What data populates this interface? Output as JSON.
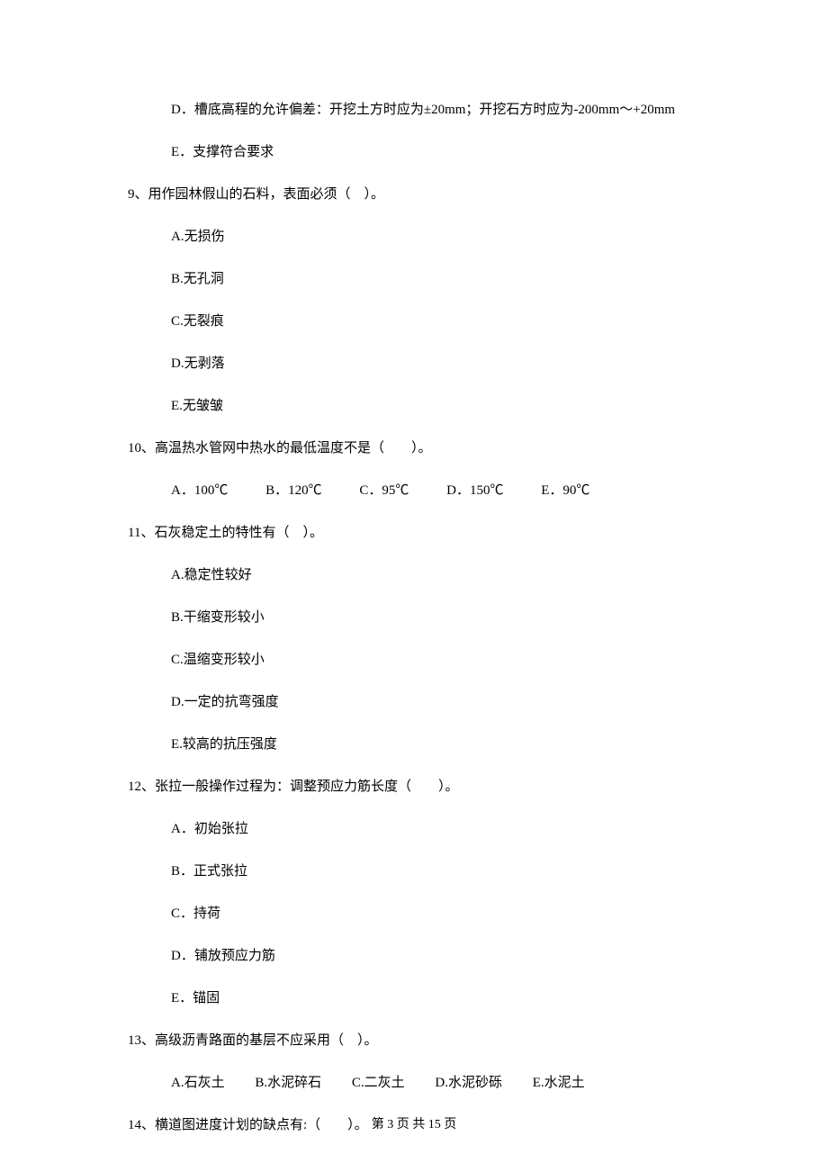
{
  "pre_options": {
    "D": "D．槽底高程的允许偏差：开挖土方时应为±20mm；开挖石方时应为-200mm～+20mm",
    "E": "E．支撑符合要求"
  },
  "q9": {
    "stem": "9、用作园林假山的石料，表面必须（　）。",
    "A": "A.无损伤",
    "B": "B.无孔洞",
    "C": "C.无裂痕",
    "D": "D.无剥落",
    "E": "E.无皱皱"
  },
  "q10": {
    "stem": "10、高温热水管网中热水的最低温度不是（　　）。",
    "A": "A．100℃",
    "B": "B．120℃",
    "C": "C．95℃",
    "D": "D．150℃",
    "E": "E．90℃"
  },
  "q11": {
    "stem": "11、石灰稳定土的特性有（　）。",
    "A": "A.稳定性较好",
    "B": "B.干缩变形较小",
    "C": "C.温缩变形较小",
    "D": "D.一定的抗弯强度",
    "E": "E.较高的抗压强度"
  },
  "q12": {
    "stem": "12、张拉一般操作过程为：调整预应力筋长度（　　）。",
    "A": "A．初始张拉",
    "B": "B．正式张拉",
    "C": "C．持荷",
    "D": "D．铺放预应力筋",
    "E": "E．锚固"
  },
  "q13": {
    "stem": "13、高级沥青路面的基层不应采用（　）。",
    "A": "A.石灰土",
    "B": "B.水泥碎石",
    "C": "C.二灰土",
    "D": "D.水泥砂砾",
    "E": "E.水泥土"
  },
  "q14": {
    "stem": "14、横道图进度计划的缺点有:（　　）。"
  },
  "footer": "第 3 页 共 15 页"
}
